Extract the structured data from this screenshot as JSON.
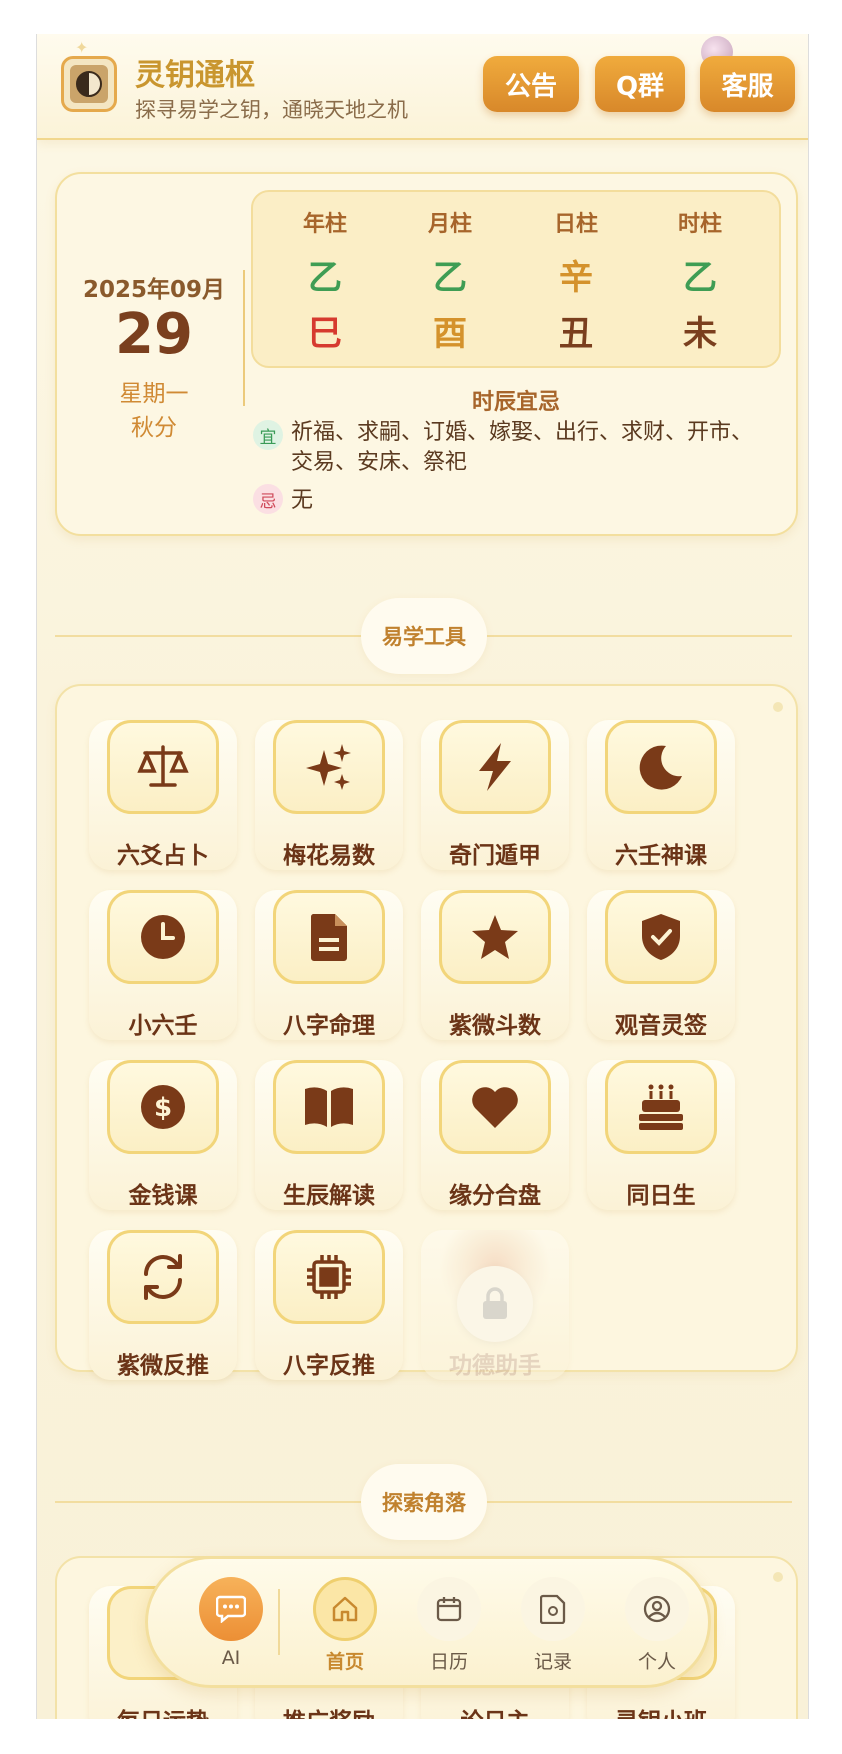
{
  "header": {
    "app_title": "灵钥通枢",
    "subtitle": "探寻易学之钥，通晓天地之机",
    "buttons": {
      "notice": "公告",
      "group": "Q群",
      "service": "客服"
    }
  },
  "date": {
    "year_month": "2025年09月",
    "day": "29",
    "weekday": "星期一",
    "solar_term": "秋分"
  },
  "pillars": [
    {
      "label": "年柱",
      "stem": "乙",
      "branch": "巳",
      "stem_color": "#3f9d54",
      "branch_color": "#d63a2f"
    },
    {
      "label": "月柱",
      "stem": "乙",
      "branch": "酉",
      "stem_color": "#3f9d54",
      "branch_color": "#d4922c"
    },
    {
      "label": "日柱",
      "stem": "辛",
      "branch": "丑",
      "stem_color": "#d4922c",
      "branch_color": "#7a3f1e"
    },
    {
      "label": "时柱",
      "stem": "乙",
      "branch": "未",
      "stem_color": "#3f9d54",
      "branch_color": "#7a3f1e"
    }
  ],
  "yiji": {
    "title": "时辰宜忌",
    "yi_badge": "宜",
    "yi_text": "祈福、求嗣、订婚、嫁娶、出行、求财、开市、交易、安床、祭祀",
    "ji_badge": "忌",
    "ji_text": "无"
  },
  "sections": {
    "tools": "易学工具",
    "explore": "探索角落"
  },
  "tools": [
    {
      "label": "六爻占卜",
      "icon": "scale-icon"
    },
    {
      "label": "梅花易数",
      "icon": "sparkles-icon"
    },
    {
      "label": "奇门遁甲",
      "icon": "bolt-icon"
    },
    {
      "label": "六壬神课",
      "icon": "moon-icon"
    },
    {
      "label": "小六壬",
      "icon": "clock-icon"
    },
    {
      "label": "八字命理",
      "icon": "document-icon"
    },
    {
      "label": "紫微斗数",
      "icon": "star-icon"
    },
    {
      "label": "观音灵签",
      "icon": "shield-check-icon"
    },
    {
      "label": "金钱课",
      "icon": "dollar-coin-icon"
    },
    {
      "label": "生辰解读",
      "icon": "book-icon"
    },
    {
      "label": "缘分合盘",
      "icon": "heart-icon"
    },
    {
      "label": "同日生",
      "icon": "cake-icon"
    },
    {
      "label": "紫微反推",
      "icon": "refresh-icon"
    },
    {
      "label": "八字反推",
      "icon": "chip-icon"
    },
    {
      "label": "功德助手",
      "icon": "lock-icon",
      "locked": true
    }
  ],
  "explore": [
    "每日运势",
    "推广奖励",
    "论日主",
    "灵钥小班"
  ],
  "nav": {
    "ai": "AI",
    "home": "首页",
    "calendar": "日历",
    "records": "记录",
    "profile": "个人"
  }
}
